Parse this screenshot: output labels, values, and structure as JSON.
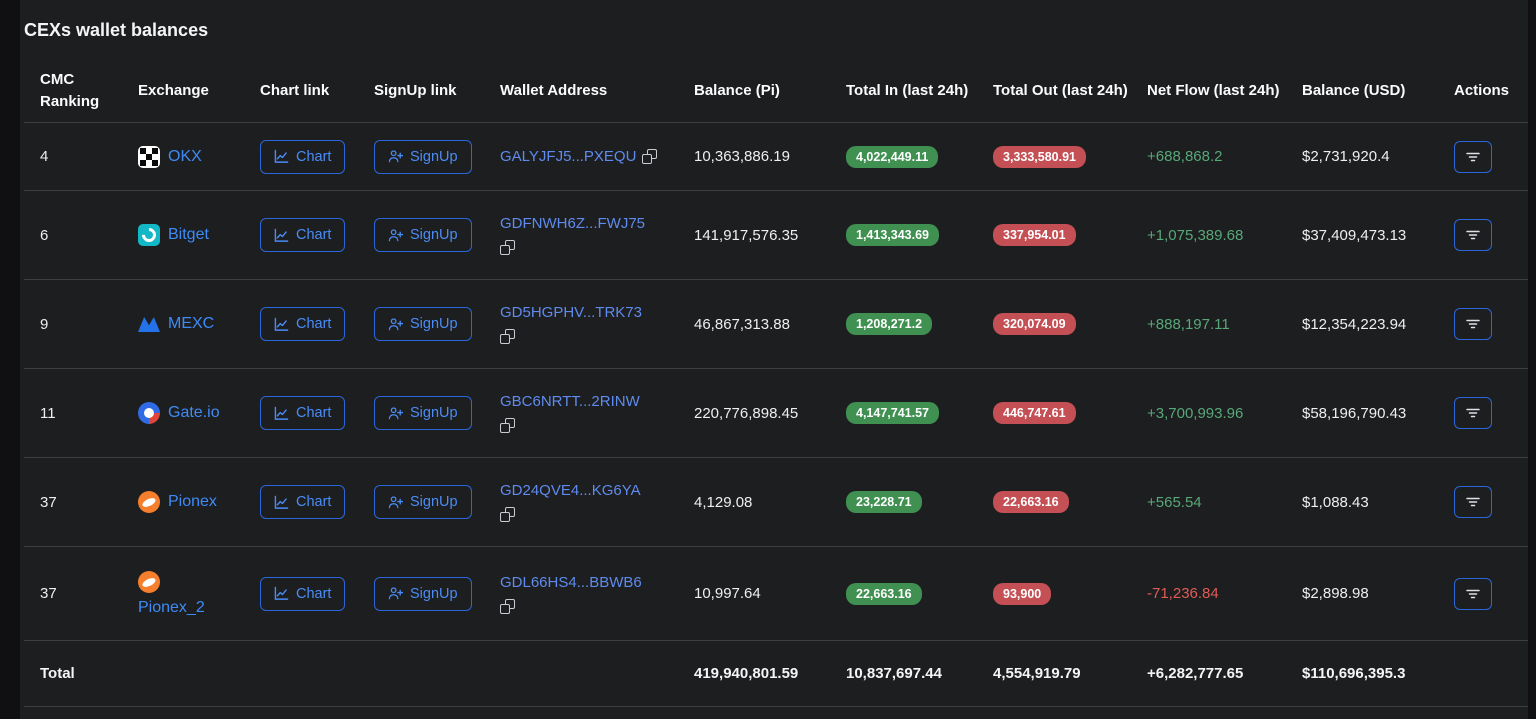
{
  "title": "CEXs wallet balances",
  "columns": {
    "ranking": "CMC Ranking",
    "exchange": "Exchange",
    "chart": "Chart link",
    "signup": "SignUp link",
    "wallet": "Wallet Address",
    "balance_pi": "Balance (Pi)",
    "total_in": "Total In (last 24h)",
    "total_out": "Total Out (last 24h)",
    "net_flow": "Net Flow (last 24h)",
    "balance_usd": "Balance (USD)",
    "actions": "Actions"
  },
  "buttons": {
    "chart": "Chart",
    "signup": "SignUp"
  },
  "rows": [
    {
      "ranking": "4",
      "exchange": "OKX",
      "exchange_icon": "okx-logo",
      "address": "GALYJFJ5...PXEQU",
      "balance_pi": "10,363,886.19",
      "total_in": "4,022,449.11",
      "total_out": "3,333,580.91",
      "net_flow": "+688,868.2",
      "net_flow_direction": "positive",
      "balance_usd": "$2,731,920.4"
    },
    {
      "ranking": "6",
      "exchange": "Bitget",
      "exchange_icon": "bitget-logo",
      "address": "GDFNWH6Z...FWJ75",
      "balance_pi": "141,917,576.35",
      "total_in": "1,413,343.69",
      "total_out": "337,954.01",
      "net_flow": "+1,075,389.68",
      "net_flow_direction": "positive",
      "balance_usd": "$37,409,473.13"
    },
    {
      "ranking": "9",
      "exchange": "MEXC",
      "exchange_icon": "mexc-logo",
      "address": "GD5HGPHV...TRK73",
      "balance_pi": "46,867,313.88",
      "total_in": "1,208,271.2",
      "total_out": "320,074.09",
      "net_flow": "+888,197.11",
      "net_flow_direction": "positive",
      "balance_usd": "$12,354,223.94"
    },
    {
      "ranking": "11",
      "exchange": "Gate.io",
      "exchange_icon": "gateio-logo",
      "address": "GBC6NRTT...2RINW",
      "balance_pi": "220,776,898.45",
      "total_in": "4,147,741.57",
      "total_out": "446,747.61",
      "net_flow": "+3,700,993.96",
      "net_flow_direction": "positive",
      "balance_usd": "$58,196,790.43"
    },
    {
      "ranking": "37",
      "exchange": "Pionex",
      "exchange_icon": "pionex-logo",
      "address": "GD24QVE4...KG6YA",
      "balance_pi": "4,129.08",
      "total_in": "23,228.71",
      "total_out": "22,663.16",
      "net_flow": "+565.54",
      "net_flow_direction": "positive",
      "balance_usd": "$1,088.43"
    },
    {
      "ranking": "37",
      "exchange": "Pionex_2",
      "exchange_icon": "pionex-logo",
      "address": "GDL66HS4...BBWB6",
      "balance_pi": "10,997.64",
      "total_in": "22,663.16",
      "total_out": "93,900",
      "net_flow": "-71,236.84",
      "net_flow_direction": "negative",
      "balance_usd": "$2,898.98"
    }
  ],
  "total": {
    "label": "Total",
    "balance_pi": "419,940,801.59",
    "total_in": "10,837,697.44",
    "total_out": "4,554,919.79",
    "net_flow": "+6,282,777.65",
    "net_flow_direction": "positive",
    "balance_usd": "$110,696,395.3"
  },
  "colors": {
    "accent_blue": "#4a8cf6",
    "exchange_blue": "#3e8bf7",
    "address_blue": "#5f8bee",
    "badge_green": "#3f9051",
    "badge_red": "#c44f55",
    "positive_green": "#58a878",
    "negative_red": "#e05b55"
  }
}
